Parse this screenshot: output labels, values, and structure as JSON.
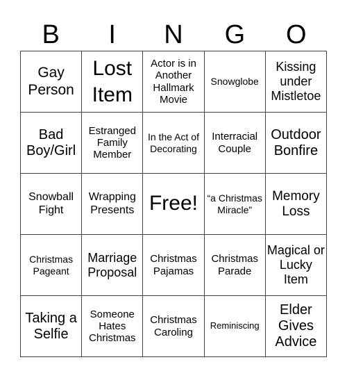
{
  "header": [
    "B",
    "I",
    "N",
    "G",
    "O"
  ],
  "cells": [
    [
      "Gay Person",
      "Lost Item",
      "Actor is in Another Hallmark Movie",
      "Snowglobe",
      "Kissing under Mistletoe"
    ],
    [
      "Bad Boy/Girl",
      "Estranged Family Member",
      "In the Act of Decorating",
      "Interracial Couple",
      "Outdoor Bonfire"
    ],
    [
      "Snowball Fight",
      "Wrapping Presents",
      "Free!",
      "“a Christmas Miracle”",
      "Memory Loss"
    ],
    [
      "Christmas Pageant",
      "Marriage Proposal",
      "Christmas Pajamas",
      "Christmas Parade",
      "Magical or Lucky Item"
    ],
    [
      "Taking a Selfie",
      "Someone Hates Christmas",
      "Christmas Caroling",
      "Reminiscing",
      "Elder Gives Advice"
    ]
  ]
}
